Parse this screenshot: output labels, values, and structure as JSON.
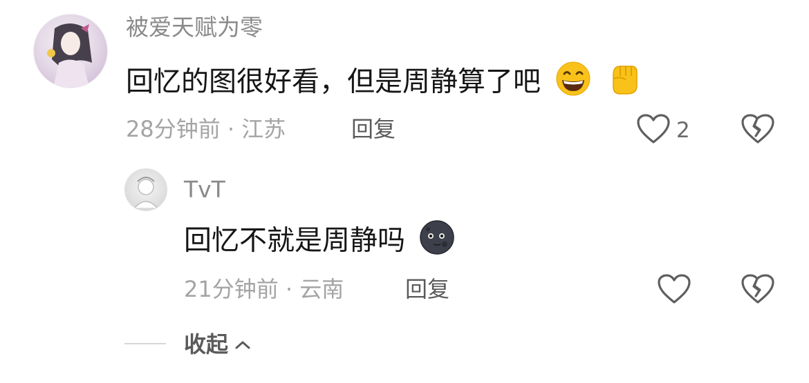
{
  "comment": {
    "username": "被爱天赋为零",
    "text": "回忆的图很好看，但是周静算了吧",
    "emojis": [
      "grinning-face-icon",
      "raised-fist-icon"
    ],
    "time": "28分钟前",
    "separator": "·",
    "location": "江苏",
    "reply_label": "回复",
    "like_count": "2"
  },
  "reply": {
    "username": "TvT",
    "text": "回忆不就是周静吗",
    "emojis": [
      "new-moon-face-icon"
    ],
    "time": "21分钟前",
    "separator": "·",
    "location": "云南",
    "reply_label": "回复"
  },
  "collapse": {
    "label": "收起",
    "icon": "chevron-up-icon"
  },
  "colors": {
    "username": "#8a8a8a",
    "text": "#161616",
    "meta": "#a4a4a4",
    "icon": "#5f5f5f",
    "emoji_yellow": "#f9c21a"
  }
}
